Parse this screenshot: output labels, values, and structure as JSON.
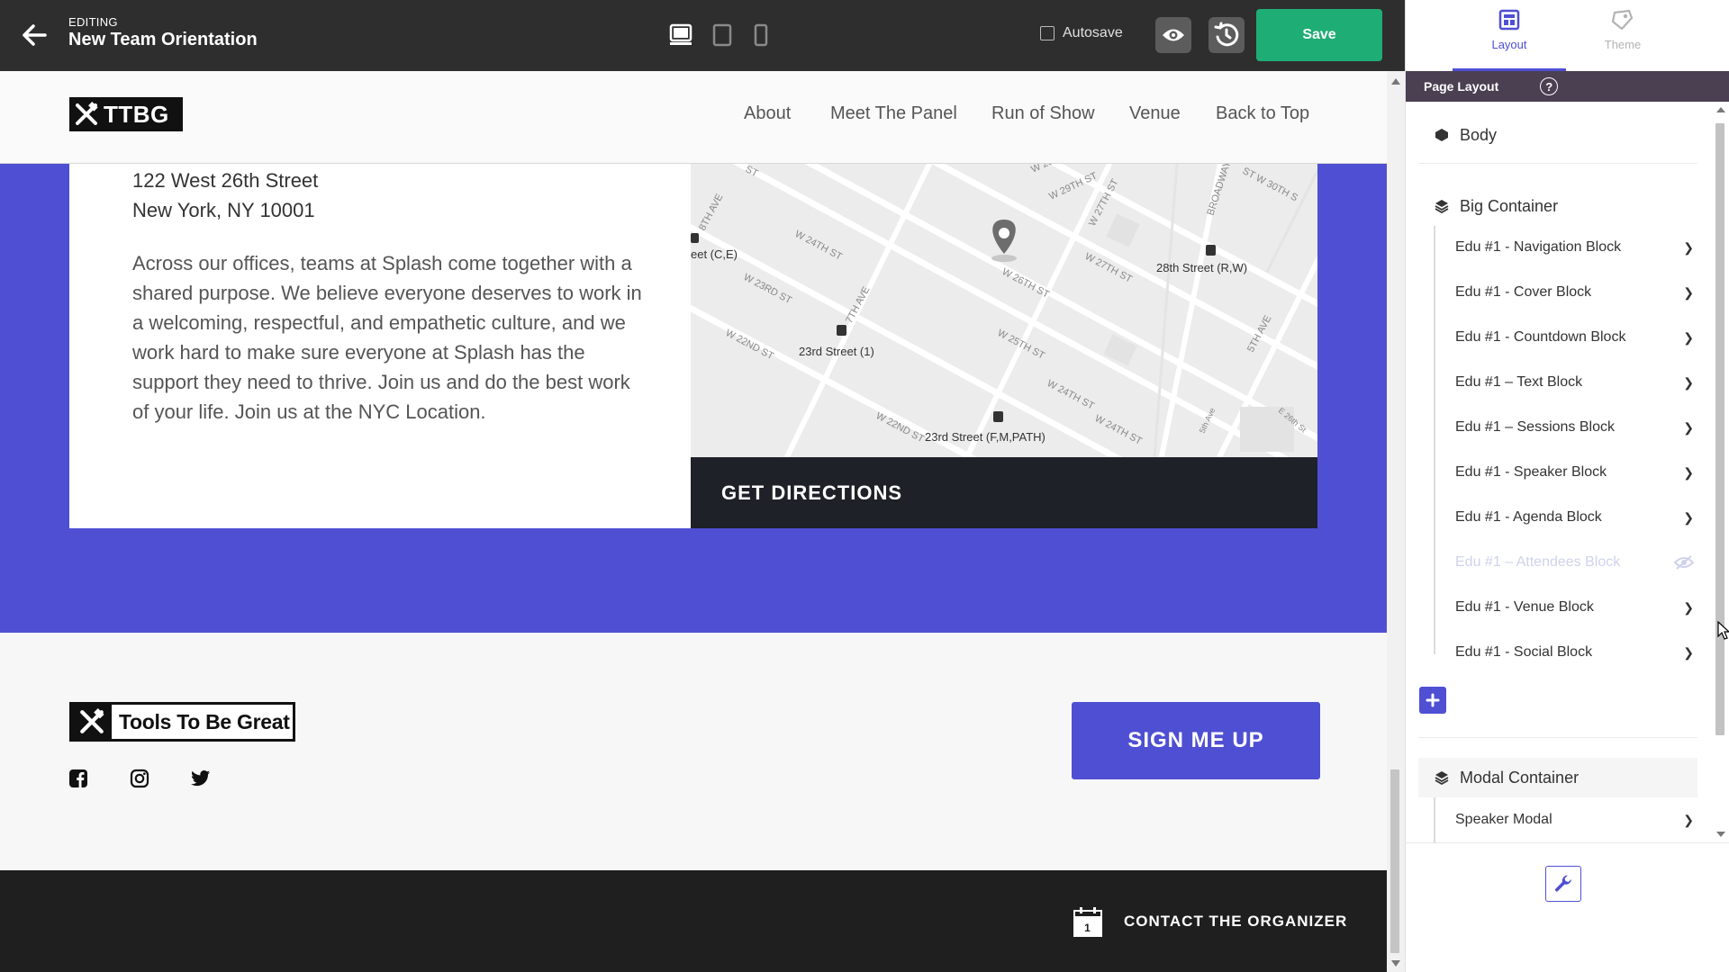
{
  "editor": {
    "status_label": "EDITING",
    "document_title": "New Team Orientation",
    "autosave_label": "Autosave",
    "autosave_checked": false,
    "save_label": "Save",
    "device_options": [
      "desktop-icon",
      "tablet-icon",
      "mobile-icon"
    ],
    "selected_device": "desktop"
  },
  "site": {
    "brand": "TTBG",
    "nav_links": [
      "About",
      "Meet The Panel",
      "Run of Show",
      "Venue",
      "Back to Top"
    ],
    "address_line1": "122 West 26th Street",
    "address_line2": "New York, NY 10001",
    "paragraph": "Across our offices, teams at Splash come together with a shared purpose. We believe everyone deserves to work in a welcoming, respectful, and empathetic culture, and we work hard to make sure everyone at Splash has the support they need to thrive. Join us and do the best work of your life. Join us at the NYC Location.",
    "directions_label": "GET DIRECTIONS",
    "map_labels": {
      "s1": "eet (C,E)",
      "s2": "23rd Street (1)",
      "s3": "28th Street (R,W)",
      "s4": "23rd Street (F,M,PATH)",
      "st1": "W 28TH ST",
      "st2": "W 27TH ST",
      "st3": "W 26TH ST",
      "st4": "W 25TH ST",
      "st5": "W 24TH ST",
      "st6": "W 24TH ST",
      "st7": "W 23RD ST",
      "st8": "W 22ND ST",
      "st9": "W 22ND ST",
      "st10": "W 24TH ST",
      "av1": "7TH AVE",
      "av2": "8TH AVE",
      "av3": "W 27TH ST",
      "av4": "BROADWAY",
      "av5": "5TH AVE",
      "st11": "ST W 30TH S",
      "st12": "E 26th St",
      "st13": "W 29TH ST",
      "st14": "5th Ave",
      "st15": "ST"
    },
    "footer_brand": "Tools To Be Great",
    "social_icons": [
      "facebook-icon",
      "instagram-icon",
      "twitter-icon"
    ],
    "signup_label": "SIGN ME UP",
    "contact_label": "CONTACT THE ORGANIZER",
    "calendar_day": "1"
  },
  "panel": {
    "tabs": [
      {
        "label": "Layout",
        "active": true
      },
      {
        "label": "Theme",
        "active": false
      }
    ],
    "section_title": "Page Layout",
    "help_glyph": "?",
    "body_label": "Body",
    "big_container_label": "Big Container",
    "big_container_items": [
      {
        "label": "Edu #1 - Navigation Block",
        "hidden": false
      },
      {
        "label": "Edu #1 - Cover Block",
        "hidden": false
      },
      {
        "label": "Edu #1 - Countdown Block",
        "hidden": false
      },
      {
        "label": "Edu #1 – Text Block",
        "hidden": false
      },
      {
        "label": "Edu #1 – Sessions Block",
        "hidden": false
      },
      {
        "label": "Edu #1 - Speaker Block",
        "hidden": false
      },
      {
        "label": "Edu #1 - Agenda Block",
        "hidden": false
      },
      {
        "label": "Edu #1 – Attendees Block",
        "hidden": true
      },
      {
        "label": "Edu #1 - Venue Block",
        "hidden": false
      },
      {
        "label": "Edu #1 - Social Block",
        "hidden": false
      }
    ],
    "modal_container_label": "Modal Container",
    "modal_items": [
      {
        "label": "Speaker Modal"
      }
    ]
  },
  "colors": {
    "accent": "#4f4fd3",
    "save_green": "#1fad76",
    "topbar": "#2e2e2e",
    "dark_bar": "#1e2127",
    "panel_header": "#4b3f52"
  }
}
